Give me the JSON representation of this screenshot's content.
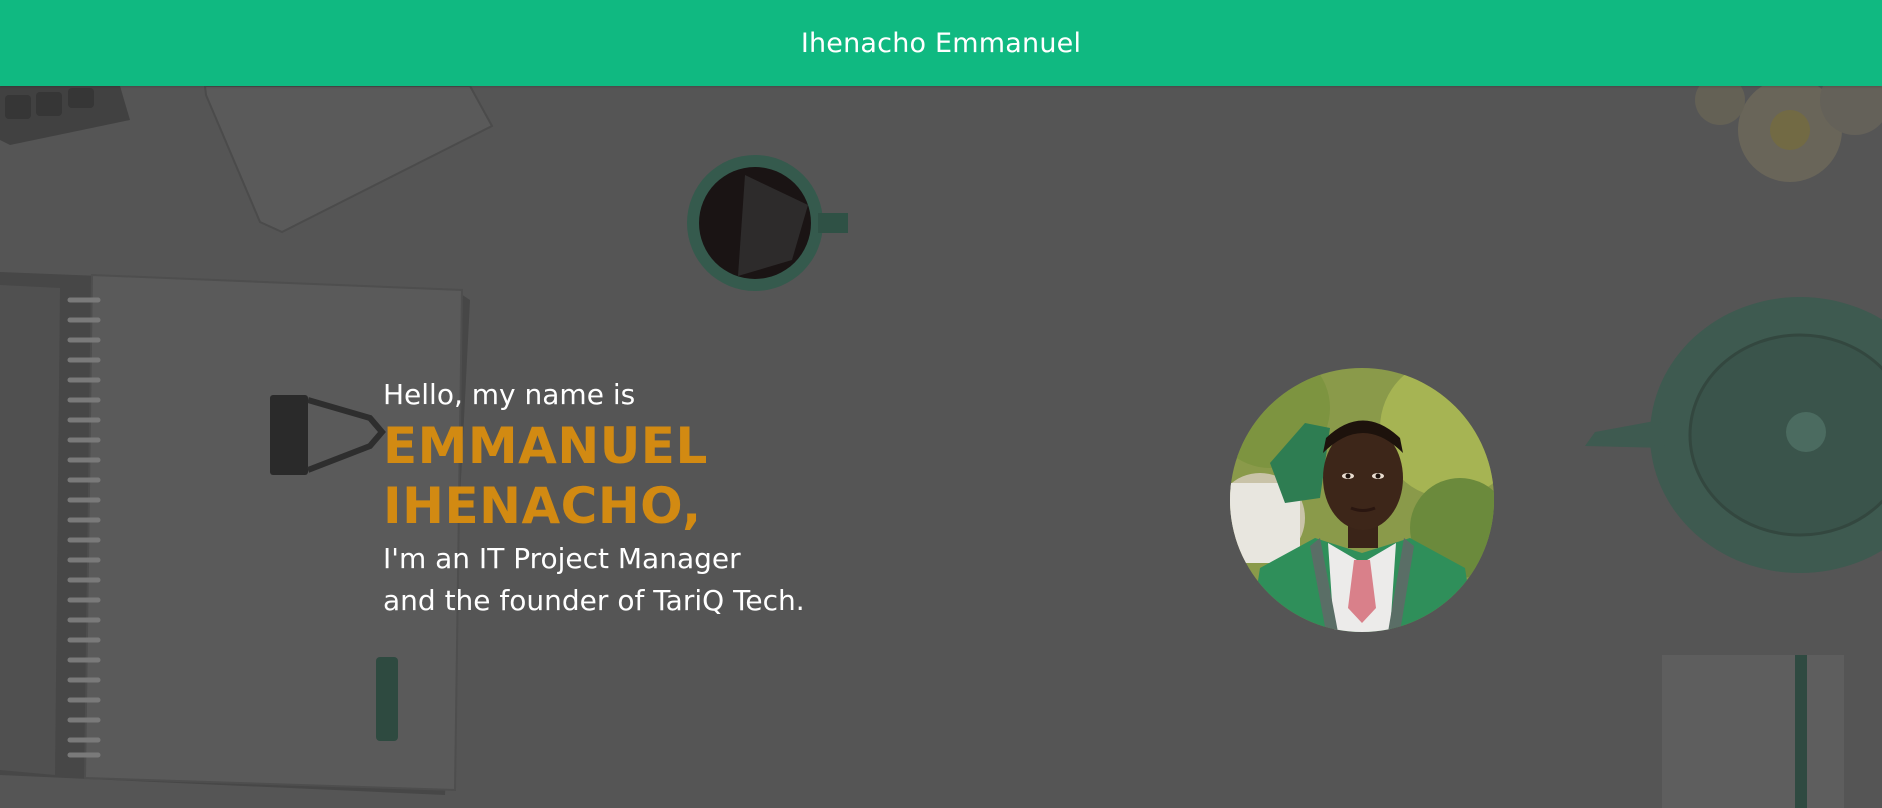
{
  "header": {
    "brand_title": "Ihenacho Emmanuel"
  },
  "hero": {
    "greeting": "Hello, my name is",
    "name_line_1": "EMMANUEL",
    "name_line_2": "IHENACHO,",
    "role_line_1": "I'm an IT Project Manager",
    "role_line_2": "and the founder of TariQ Tech."
  },
  "colors": {
    "header_bg": "#10b981",
    "name_accent": "#d28a12",
    "hero_bg_overlay": "#555555",
    "text_primary": "#ffffff"
  },
  "icons": {
    "avatar": "profile-photo"
  }
}
